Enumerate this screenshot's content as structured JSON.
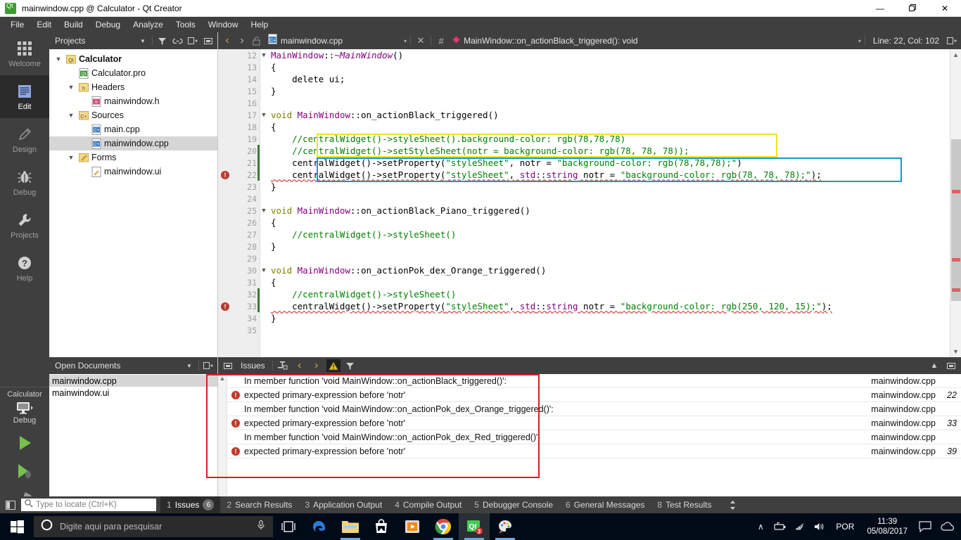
{
  "window": {
    "title": "mainwindow.cpp @ Calculator - Qt Creator",
    "minimize": "—",
    "maximize": "❐",
    "close": "✕"
  },
  "menubar": {
    "items": [
      "File",
      "Edit",
      "Build",
      "Debug",
      "Analyze",
      "Tools",
      "Window",
      "Help"
    ]
  },
  "modebar": {
    "modes": [
      {
        "label": "Welcome",
        "icon": "grid-icon",
        "active": false
      },
      {
        "label": "Edit",
        "icon": "lines-icon",
        "active": true
      },
      {
        "label": "Design",
        "icon": "pencil-icon",
        "active": false
      },
      {
        "label": "Debug",
        "icon": "bug-icon",
        "active": false
      },
      {
        "label": "Projects",
        "icon": "wrench-icon",
        "active": false
      },
      {
        "label": "Help",
        "icon": "question-icon",
        "active": false
      }
    ],
    "kit_name": "Calculator",
    "kit_mode": "Debug",
    "run_button": "run-icon",
    "debug_button": "debug-run-icon",
    "build_button": "hammer-icon"
  },
  "projects_dock": {
    "title": "Projects",
    "toolbar_icons": [
      "chevron-down-icon",
      "filter-icon",
      "link-icon",
      "split-icon",
      "close-dock-icon"
    ],
    "tree": [
      {
        "label": "Calculator",
        "indent": 0,
        "arrow": "v",
        "icon": "qt-project-icon",
        "bold": true,
        "selected": false
      },
      {
        "label": "Calculator.pro",
        "indent": 1,
        "arrow": "",
        "icon": "pro-file-icon",
        "bold": false,
        "selected": false
      },
      {
        "label": "Headers",
        "indent": 1,
        "arrow": "v",
        "icon": "headers-folder-icon",
        "bold": false,
        "selected": false
      },
      {
        "label": "mainwindow.h",
        "indent": 2,
        "arrow": "",
        "icon": "h-file-icon",
        "bold": false,
        "selected": false
      },
      {
        "label": "Sources",
        "indent": 1,
        "arrow": "v",
        "icon": "sources-folder-icon",
        "bold": false,
        "selected": false
      },
      {
        "label": "main.cpp",
        "indent": 2,
        "arrow": "",
        "icon": "cpp-file-icon",
        "bold": false,
        "selected": false
      },
      {
        "label": "mainwindow.cpp",
        "indent": 2,
        "arrow": "",
        "icon": "cpp-file-icon",
        "bold": false,
        "selected": true
      },
      {
        "label": "Forms",
        "indent": 1,
        "arrow": "v",
        "icon": "forms-folder-icon",
        "bold": false,
        "selected": false
      },
      {
        "label": "mainwindow.ui",
        "indent": 2,
        "arrow": "",
        "icon": "ui-file-icon",
        "bold": false,
        "selected": false
      }
    ]
  },
  "editor_toolbar": {
    "back": "‹",
    "forward": "›",
    "lock": "unlock-icon",
    "file_icon": "cpp-file-icon",
    "file_name": "mainwindow.cpp",
    "dropdown": "▾",
    "close": "✕",
    "hash": "#",
    "symbol_icon": "method-icon",
    "symbol_name": "MainWindow::on_actionBlack_triggered(): void",
    "symbol_dropdown": "▾",
    "line_col": "Line: 22, Col: 102",
    "split_icon": "split-icon"
  },
  "code": {
    "first_line_number": 12,
    "lines": [
      {
        "n": 12,
        "fold": "v",
        "err": false,
        "changed": false,
        "tokens": [
          {
            "t": "MainWindow",
            "c": "typ"
          },
          {
            "t": "::",
            "c": "plain"
          },
          {
            "t": "~MainWindow",
            "c": "typ ital"
          },
          {
            "t": "()",
            "c": "plain"
          }
        ]
      },
      {
        "n": 13,
        "fold": "",
        "err": false,
        "changed": false,
        "tokens": [
          {
            "t": "{",
            "c": "plain"
          }
        ]
      },
      {
        "n": 14,
        "fold": "",
        "err": false,
        "changed": false,
        "tokens": [
          {
            "t": "    delete ui;",
            "c": "plain"
          }
        ]
      },
      {
        "n": 15,
        "fold": "",
        "err": false,
        "changed": false,
        "tokens": [
          {
            "t": "}",
            "c": "plain"
          }
        ]
      },
      {
        "n": 16,
        "fold": "",
        "err": false,
        "changed": false,
        "tokens": [
          {
            "t": "",
            "c": "plain"
          }
        ]
      },
      {
        "n": 17,
        "fold": "v",
        "err": false,
        "changed": false,
        "tokens": [
          {
            "t": "void ",
            "c": "k"
          },
          {
            "t": "MainWindow",
            "c": "typ"
          },
          {
            "t": "::on_actionBlack_triggered()",
            "c": "plain"
          }
        ]
      },
      {
        "n": 18,
        "fold": "",
        "err": false,
        "changed": false,
        "tokens": [
          {
            "t": "{",
            "c": "plain"
          }
        ]
      },
      {
        "n": 19,
        "fold": "",
        "err": false,
        "changed": false,
        "tokens": [
          {
            "t": "    //centralWidget()->styleSheet().background-color: rgb(78,78,78)",
            "c": "cm"
          }
        ]
      },
      {
        "n": 20,
        "fold": "",
        "err": false,
        "changed": true,
        "tokens": [
          {
            "t": "    //centralWidget()->setStyleSheet(notr = background-color: rgb(78, 78, 78));",
            "c": "cm"
          }
        ]
      },
      {
        "n": 21,
        "fold": "",
        "err": false,
        "changed": true,
        "tokens": [
          {
            "t": "    centralWidget()->setProperty(",
            "c": "plain"
          },
          {
            "t": "\"styleSheet\"",
            "c": "str"
          },
          {
            "t": ", notr = ",
            "c": "plain"
          },
          {
            "t": "\"background-color: rgb(78,78,78);\"",
            "c": "str"
          },
          {
            "t": ")",
            "c": "plain"
          }
        ]
      },
      {
        "n": 22,
        "fold": "",
        "err": true,
        "changed": true,
        "error_underline": true,
        "tokens": [
          {
            "t": "    centralWidget()->setProperty(",
            "c": "plain"
          },
          {
            "t": "\"styleSheet\"",
            "c": "str"
          },
          {
            "t": ", ",
            "c": "plain"
          },
          {
            "t": "std",
            "c": "typ"
          },
          {
            "t": "::",
            "c": "plain"
          },
          {
            "t": "string",
            "c": "typ"
          },
          {
            "t": " notr = ",
            "c": "plain"
          },
          {
            "t": "\"background-color: rgb(78, 78, 78);\"",
            "c": "str"
          },
          {
            "t": ");",
            "c": "plain"
          }
        ]
      },
      {
        "n": 23,
        "fold": "",
        "err": false,
        "changed": false,
        "tokens": [
          {
            "t": "}",
            "c": "plain"
          }
        ]
      },
      {
        "n": 24,
        "fold": "",
        "err": false,
        "changed": false,
        "tokens": [
          {
            "t": "",
            "c": "plain"
          }
        ]
      },
      {
        "n": 25,
        "fold": "v",
        "err": false,
        "changed": false,
        "tokens": [
          {
            "t": "void ",
            "c": "k"
          },
          {
            "t": "MainWindow",
            "c": "typ"
          },
          {
            "t": "::on_actionBlack_Piano_triggered()",
            "c": "plain"
          }
        ]
      },
      {
        "n": 26,
        "fold": "",
        "err": false,
        "changed": false,
        "tokens": [
          {
            "t": "{",
            "c": "plain"
          }
        ]
      },
      {
        "n": 27,
        "fold": "",
        "err": false,
        "changed": false,
        "tokens": [
          {
            "t": "    //centralWidget()->styleSheet()",
            "c": "cm"
          }
        ]
      },
      {
        "n": 28,
        "fold": "",
        "err": false,
        "changed": false,
        "tokens": [
          {
            "t": "}",
            "c": "plain"
          }
        ]
      },
      {
        "n": 29,
        "fold": "",
        "err": false,
        "changed": false,
        "tokens": [
          {
            "t": "",
            "c": "plain"
          }
        ]
      },
      {
        "n": 30,
        "fold": "v",
        "err": false,
        "changed": false,
        "tokens": [
          {
            "t": "void ",
            "c": "k"
          },
          {
            "t": "MainWindow",
            "c": "typ"
          },
          {
            "t": "::on_actionPok_dex_Orange_triggered()",
            "c": "plain"
          }
        ]
      },
      {
        "n": 31,
        "fold": "",
        "err": false,
        "changed": false,
        "tokens": [
          {
            "t": "{",
            "c": "plain"
          }
        ]
      },
      {
        "n": 32,
        "fold": "",
        "err": false,
        "changed": true,
        "tokens": [
          {
            "t": "    //centralWidget()->styleSheet()",
            "c": "cm"
          }
        ]
      },
      {
        "n": 33,
        "fold": "",
        "err": true,
        "changed": true,
        "error_underline": true,
        "tokens": [
          {
            "t": "    centralWidget()->setProperty(",
            "c": "plain"
          },
          {
            "t": "\"styleSheet\"",
            "c": "str"
          },
          {
            "t": ", ",
            "c": "plain"
          },
          {
            "t": "std",
            "c": "typ"
          },
          {
            "t": "::",
            "c": "plain"
          },
          {
            "t": "string",
            "c": "typ"
          },
          {
            "t": " notr = ",
            "c": "plain"
          },
          {
            "t": "\"background-color: rgb(250, 120, 15);\"",
            "c": "str"
          },
          {
            "t": ");",
            "c": "plain"
          }
        ]
      },
      {
        "n": 34,
        "fold": "",
        "err": false,
        "changed": false,
        "tokens": [
          {
            "t": "}",
            "c": "plain"
          }
        ]
      },
      {
        "n": 35,
        "fold": "",
        "err": false,
        "changed": false,
        "tokens": [
          {
            "t": "",
            "c": "plain"
          }
        ]
      }
    ],
    "annotations": {
      "yellow_box_color": "#f2e41c",
      "blue_box_color": "#1997c9",
      "red_box_color": "#e01b1b"
    }
  },
  "open_documents": {
    "title": "Open Documents",
    "items": [
      {
        "name": "mainwindow.cpp",
        "selected": true
      },
      {
        "name": "mainwindow.ui",
        "selected": false
      }
    ]
  },
  "issues": {
    "title": "Issues",
    "toolbar_icons": [
      "expand-icon",
      "prev-issue-icon",
      "next-issue-icon",
      "warning-filter-icon",
      "filter-icon"
    ],
    "columns": [
      "description",
      "file",
      "line"
    ],
    "rows": [
      {
        "severity": "none",
        "description": "In member function 'void MainWindow::on_actionBlack_triggered()':",
        "file": "mainwindow.cpp",
        "line": ""
      },
      {
        "severity": "error",
        "description": "expected primary-expression before 'notr'",
        "file": "mainwindow.cpp",
        "line": "22"
      },
      {
        "severity": "none",
        "description": "In member function 'void MainWindow::on_actionPok_dex_Orange_triggered()':",
        "file": "mainwindow.cpp",
        "line": ""
      },
      {
        "severity": "error",
        "description": "expected primary-expression before 'notr'",
        "file": "mainwindow.cpp",
        "line": "33"
      },
      {
        "severity": "none",
        "description": "In member function 'void MainWindow::on_actionPok_dex_Red_triggered()':",
        "file": "mainwindow.cpp",
        "line": ""
      },
      {
        "severity": "error",
        "description": "expected primary-expression before 'notr'",
        "file": "mainwindow.cpp",
        "line": "39"
      }
    ]
  },
  "statusbar": {
    "sidebar_toggle": "sidebar-icon",
    "locator_placeholder": "Type to locate (Ctrl+K)",
    "locator_value": "",
    "tabs": [
      {
        "num": "1",
        "label": "Issues",
        "badge": "6",
        "active": true
      },
      {
        "num": "2",
        "label": "Search Results",
        "badge": "",
        "active": false
      },
      {
        "num": "3",
        "label": "Application Output",
        "badge": "",
        "active": false
      },
      {
        "num": "4",
        "label": "Compile Output",
        "badge": "",
        "active": false
      },
      {
        "num": "5",
        "label": "Debugger Console",
        "badge": "",
        "active": false
      },
      {
        "num": "6",
        "label": "General Messages",
        "badge": "",
        "active": false
      },
      {
        "num": "8",
        "label": "Test Results",
        "badge": "",
        "active": false
      }
    ],
    "resize_handle": "↕"
  },
  "taskbar": {
    "start_icon": "windows-icon",
    "search_placeholder": "Digite aqui para pesquisar",
    "search_icon": "cortana-circle-icon",
    "mic_icon": "microphone-icon",
    "taskview_icon": "task-view-icon",
    "apps": [
      {
        "name": "edge-icon",
        "active": false,
        "badge": ""
      },
      {
        "name": "file-explorer-icon",
        "active": false,
        "badge": ""
      },
      {
        "name": "microsoft-store-icon",
        "active": false,
        "badge": ""
      },
      {
        "name": "media-player-icon",
        "active": false,
        "badge": ""
      },
      {
        "name": "chrome-icon",
        "active": false,
        "badge": ""
      },
      {
        "name": "qt-creator-icon",
        "active": true,
        "badge": "3"
      },
      {
        "name": "paint-icon",
        "active": false,
        "badge": ""
      }
    ],
    "tray": {
      "show_hidden": "∧",
      "battery": "battery-icon",
      "wifi": "wifi-icon",
      "volume": "volume-icon",
      "language": "POR",
      "time": "11:39",
      "date": "05/08/2017",
      "notifications": "action-center-icon",
      "cloud": "onedrive-cloud-icon"
    }
  }
}
